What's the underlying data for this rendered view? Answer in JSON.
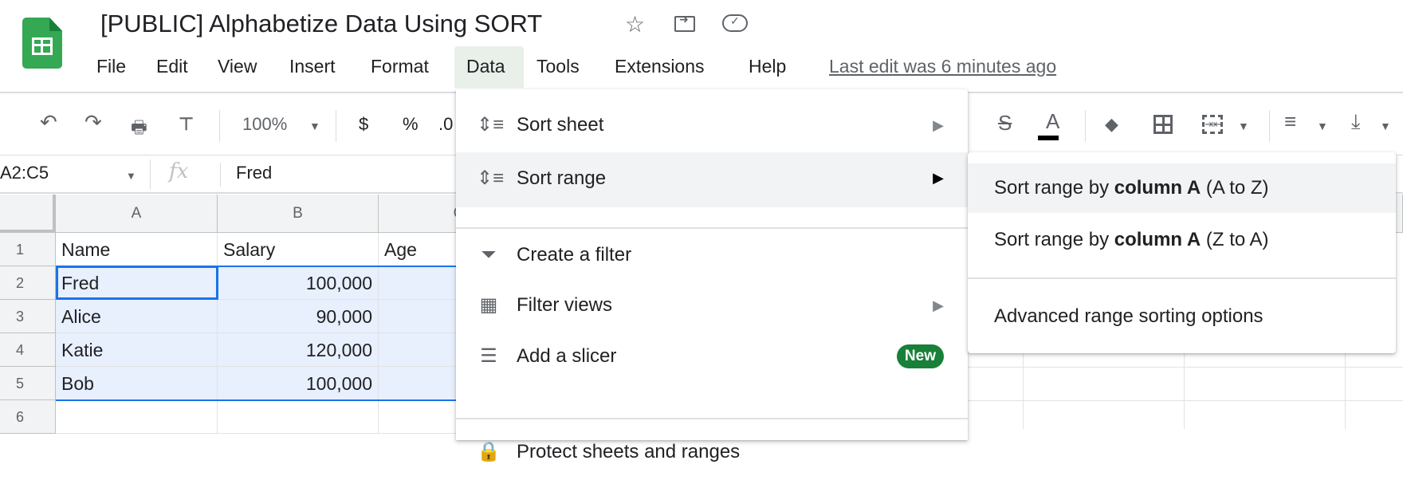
{
  "app": {
    "title": "[PUBLIC] Alphabetize Data Using SORT",
    "icons": [
      "star-icon",
      "move-to-folder-icon",
      "cloud-saved-icon"
    ]
  },
  "menubar": {
    "items": [
      "File",
      "Edit",
      "View",
      "Insert",
      "Format",
      "Data",
      "Tools",
      "Extensions",
      "Help"
    ],
    "active": "Data",
    "last_edit": "Last edit was 6 minutes ago"
  },
  "toolbar": {
    "zoom": "100%",
    "currency": "$",
    "percent": "%",
    "decimal": ".0",
    "text_color_swatch": "#000000"
  },
  "formula_bar": {
    "name_box": "A2:C5",
    "fx": "fx",
    "value": "Fred"
  },
  "grid": {
    "columns": [
      "A",
      "B",
      "C"
    ],
    "rows": [
      "1",
      "2",
      "3",
      "4",
      "5",
      "6"
    ],
    "cells": [
      [
        "Name",
        "Salary",
        "Age"
      ],
      [
        "Fred",
        "100,000",
        ""
      ],
      [
        "Alice",
        "90,000",
        ""
      ],
      [
        "Katie",
        "120,000",
        ""
      ],
      [
        "Bob",
        "100,000",
        ""
      ],
      [
        "",
        "",
        ""
      ]
    ],
    "selection": "A2:C5",
    "selection_color": "#e8f0fe",
    "accent": "#1a73e8"
  },
  "data_menu": {
    "items": [
      {
        "label": "Sort sheet",
        "icon": "sort-icon",
        "submenu": true
      },
      {
        "label": "Sort range",
        "icon": "sort-icon",
        "submenu": true,
        "highlighted": true
      },
      {
        "label": "Create a filter",
        "icon": "filter-icon"
      },
      {
        "label": "Filter views",
        "icon": "filter-views-icon",
        "submenu": true
      },
      {
        "label": "Add a slicer",
        "icon": "slicer-icon",
        "badge": "New"
      },
      {
        "label": "Protect sheets and ranges",
        "icon": "lock-icon"
      }
    ],
    "badge_color": "#188038"
  },
  "sort_range_submenu": {
    "items": [
      {
        "prefix": "Sort range by ",
        "bold": "column A",
        "suffix": " (A to Z)",
        "highlighted": true
      },
      {
        "prefix": "Sort range by ",
        "bold": "column A",
        "suffix": " (Z to A)"
      },
      {
        "label": "Advanced range sorting options"
      }
    ]
  }
}
